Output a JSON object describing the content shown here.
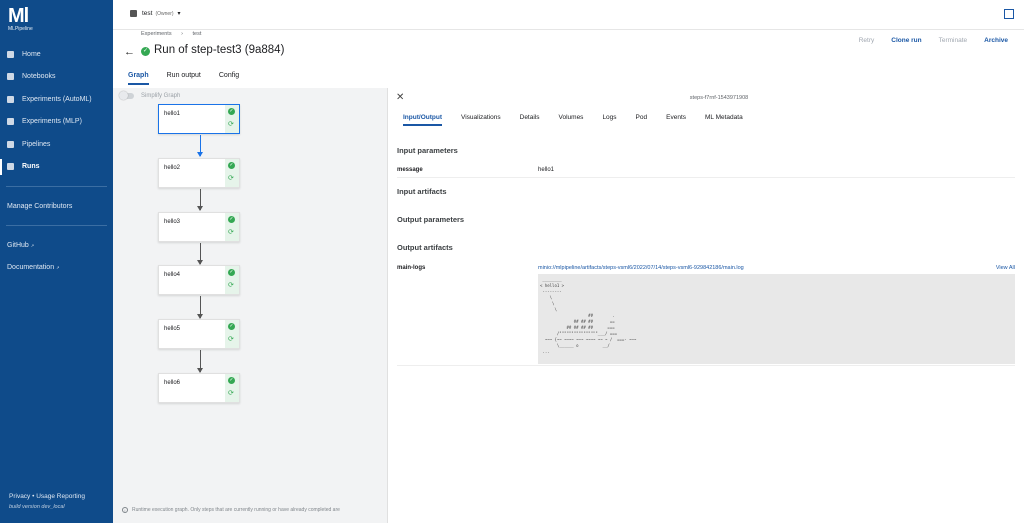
{
  "app": {
    "logo_mark": "Ml",
    "logo_text": "MLPipeline"
  },
  "sidebar": {
    "items": [
      {
        "label": "Home",
        "icon": "home-icon"
      },
      {
        "label": "Notebooks",
        "icon": "notebook-icon"
      },
      {
        "label": "Experiments (AutoML)",
        "icon": "experiment-icon"
      },
      {
        "label": "Experiments (MLP)",
        "icon": "chart-icon"
      },
      {
        "label": "Pipelines",
        "icon": "pipeline-icon"
      },
      {
        "label": "Runs",
        "icon": "run-icon"
      }
    ],
    "manage": "Manage Contributors",
    "github": "GitHub",
    "documentation": "Documentation",
    "privacy": "Privacy • Usage Reporting",
    "build": "build version dev_local"
  },
  "topbar": {
    "namespace": "test",
    "owner": "(Owner)"
  },
  "header": {
    "breadcrumbs": [
      "Experiments",
      "›",
      "test"
    ],
    "title": "Run of step-test3 (9a884)",
    "actions": {
      "retry": "Retry",
      "clone": "Clone run",
      "terminate": "Terminate",
      "archive": "Archive"
    }
  },
  "tabs": [
    "Graph",
    "Run output",
    "Config"
  ],
  "graph": {
    "simplify": "Simplify Graph",
    "nodes": [
      "hello1",
      "hello2",
      "hello3",
      "hello4",
      "hello5",
      "hello6"
    ],
    "note": "Runtime execution graph. Only steps that are currently running or have already completed are"
  },
  "panel": {
    "pod_name": "steps-f7rnf-1543971908",
    "tabs": [
      "Input/Output",
      "Visualizations",
      "Details",
      "Volumes",
      "Logs",
      "Pod",
      "Events",
      "ML Metadata"
    ],
    "input_parameters": "Input parameters",
    "message_key": "message",
    "message_value": "hello1",
    "input_artifacts": "Input artifacts",
    "output_parameters": "Output parameters",
    "output_artifacts": "Output artifacts",
    "main_logs_key": "main-logs",
    "main_logs_link": "minio://mlpipeline/artifacts/steps-vsml6/2022/07/14/steps-vsml6-929842186/main.log",
    "view_all": "View All",
    "log_text": " ________\n< hello1 >\n --------\n    \\\n     \\\n      \\\n                    ##        .\n              ## ## ##       ==\n           ## ## ## ##      ===\n       /\"\"\"\"\"\"\"\"\"\"\"\"\"\"\"\"___/ ===\n  ~~~ {~~ ~~~~ ~~~ ~~~~ ~~ ~ /  ===- ~~~\n       \\______ o          __/\n ..."
  },
  "colors": {
    "sidebar": "#0f4b8a",
    "accent": "#1a57a5",
    "success": "#34a853"
  }
}
